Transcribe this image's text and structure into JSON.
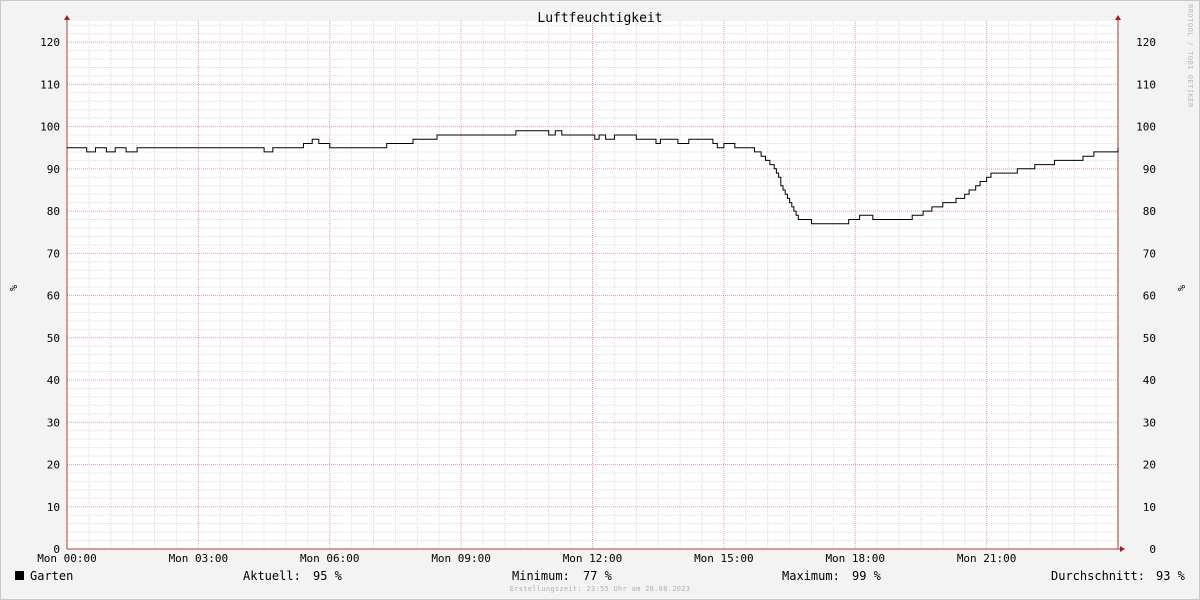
{
  "chart_data": {
    "type": "line",
    "title": "Luftfeuchtigkeit",
    "ylabel_left": "%",
    "ylabel_right": "%",
    "watermark": "RRDTOOL / TOBI OETIKER",
    "ylim": [
      0,
      125
    ],
    "yticks": [
      0,
      10,
      20,
      30,
      40,
      50,
      60,
      70,
      80,
      90,
      100,
      110,
      120
    ],
    "xlim_hours": [
      0,
      24
    ],
    "xticks": [
      {
        "hour": 0,
        "label": "Mon 00:00"
      },
      {
        "hour": 3,
        "label": "Mon 03:00"
      },
      {
        "hour": 6,
        "label": "Mon 06:00"
      },
      {
        "hour": 9,
        "label": "Mon 09:00"
      },
      {
        "hour": 12,
        "label": "Mon 12:00"
      },
      {
        "hour": 15,
        "label": "Mon 15:00"
      },
      {
        "hour": 18,
        "label": "Mon 18:00"
      },
      {
        "hour": 21,
        "label": "Mon 21:00"
      }
    ],
    "series": [
      {
        "name": "Garten",
        "color": "#000000",
        "x_hours": [
          0,
          0.45,
          0.65,
          0.9,
          1.1,
          1.35,
          1.6,
          2.2,
          4.5,
          4.7,
          5.4,
          5.6,
          5.75,
          6.0,
          6.15,
          7.3,
          7.9,
          8.45,
          9.0,
          10.25,
          10.5,
          11.0,
          11.15,
          11.3,
          11.5,
          11.8,
          12.05,
          12.15,
          12.3,
          12.5,
          12.65,
          13.0,
          13.25,
          13.45,
          13.55,
          13.95,
          14.2,
          14.65,
          14.75,
          14.85,
          15.0,
          15.25,
          15.5,
          15.7,
          15.85,
          15.95,
          16.05,
          16.15,
          16.2,
          16.25,
          16.3,
          16.35,
          16.4,
          16.45,
          16.5,
          16.55,
          16.6,
          16.65,
          16.7,
          16.8,
          16.85,
          16.9,
          17.0,
          17.3,
          17.85,
          18.1,
          18.4,
          18.75,
          19.3,
          19.55,
          19.75,
          20.0,
          20.15,
          20.3,
          20.5,
          20.6,
          20.75,
          20.85,
          21.0,
          21.1,
          21.3,
          21.7,
          21.85,
          22.1,
          22.55,
          22.95,
          23.2,
          23.45,
          23.65,
          24.0
        ],
        "values": [
          95,
          94,
          95,
          94,
          95,
          94,
          95,
          95,
          94,
          95,
          96,
          97,
          96,
          95,
          95,
          96,
          97,
          98,
          98,
          99,
          99,
          98,
          99,
          98,
          98,
          98,
          97,
          98,
          97,
          98,
          98,
          97,
          97,
          96,
          97,
          96,
          97,
          97,
          96,
          95,
          96,
          95,
          95,
          94,
          93,
          92,
          91,
          90,
          89,
          88,
          86,
          85,
          84,
          83,
          82,
          81,
          80,
          79,
          78,
          78,
          78,
          78,
          77,
          77,
          78,
          79,
          78,
          78,
          79,
          80,
          81,
          82,
          82,
          83,
          84,
          85,
          86,
          87,
          88,
          89,
          89,
          90,
          90,
          91,
          92,
          92,
          93,
          94,
          94,
          95
        ]
      }
    ]
  },
  "legend": {
    "series_name": "Garten",
    "current_label": "Aktuell:",
    "current_value": "95 %",
    "min_label": "Minimum:",
    "min_value": "77 %",
    "max_label": "Maximum:",
    "max_value": "99 %",
    "avg_label": "Durchschnitt:",
    "avg_value": "93 %"
  },
  "footer": "Erstellungszeit: 23:55 Uhr am 28.08.2023"
}
